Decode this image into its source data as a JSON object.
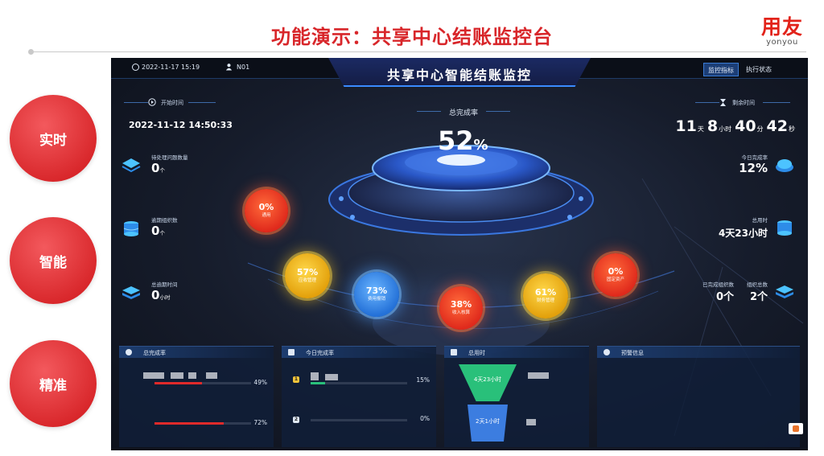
{
  "slide": {
    "title": "功能演示：共享中心结账监控台",
    "brand_cn": "用友",
    "brand_en": "yonyou"
  },
  "features": [
    "实时",
    "智能",
    "精准"
  ],
  "dashboard": {
    "datetime": "2022-11-17 15:19",
    "user": "N01",
    "title": "共享中心智能结账监控",
    "tabs": [
      "监控指标",
      "执行状态"
    ],
    "start_label": "开始时间",
    "start_time": "2022-11-12 14:50:33",
    "total_label": "总完成率",
    "total_value": "52",
    "total_unit": "%",
    "remain_label": "剩余时间",
    "remain": {
      "days": "11",
      "days_unit": "天",
      "hours": "8",
      "hours_unit": "小时",
      "minutes": "40",
      "minutes_unit": "分",
      "seconds": "42",
      "seconds_unit": "秒"
    },
    "left_metrics": [
      {
        "label": "待处理问题数量",
        "value": "0",
        "unit": "个"
      },
      {
        "label": "逾期组织数",
        "value": "0",
        "unit": "个"
      },
      {
        "label": "总逾期时间",
        "value": "0",
        "unit": "小时"
      }
    ],
    "right_metrics": [
      {
        "label": "今日完成率",
        "value": "12%"
      },
      {
        "label": "总用时",
        "value": "4天23小时"
      },
      {
        "label": "已完成组织数",
        "label2": "组织总数",
        "value": "0个",
        "value2": "2个"
      }
    ],
    "orbs": [
      {
        "pct": "0%",
        "name": "通用",
        "color": "red"
      },
      {
        "pct": "57%",
        "name": "应收管理",
        "color": "yellow"
      },
      {
        "pct": "73%",
        "name": "费用报销",
        "color": "blue"
      },
      {
        "pct": "38%",
        "name": "收入核算",
        "color": "red"
      },
      {
        "pct": "61%",
        "name": "财务管理",
        "color": "yellow"
      },
      {
        "pct": "0%",
        "name": "固定资产",
        "color": "red"
      }
    ],
    "panels": {
      "total_rate": {
        "title": "总完成率",
        "rows": [
          {
            "pct": "49%",
            "fill": 0.49
          },
          {
            "pct": "72%",
            "fill": 0.72
          }
        ]
      },
      "today_rate": {
        "title": "今日完成率",
        "rows": [
          {
            "badge": "1",
            "pct": "15%",
            "fill": 0.15
          },
          {
            "badge": "2",
            "pct": "0%",
            "fill": 0
          }
        ]
      },
      "total_time": {
        "title": "总用时",
        "top": "4天23小时",
        "bottom": "2天1小时"
      },
      "alerts": {
        "title": "预警信息"
      }
    },
    "colors": {
      "accent": "#d8262a",
      "bg": "#161c2b",
      "bar": "#e02a2a"
    }
  }
}
